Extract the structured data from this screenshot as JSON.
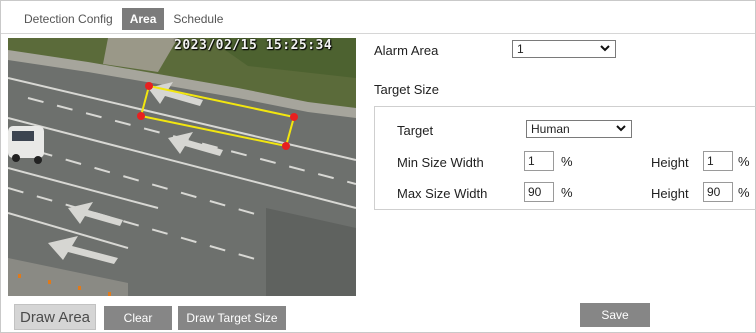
{
  "tabs": [
    {
      "label": "Detection Config",
      "active": false
    },
    {
      "label": "Area",
      "active": true
    },
    {
      "label": "Schedule",
      "active": false
    }
  ],
  "video": {
    "timestamp": "2023/02/15 15:25:34"
  },
  "form": {
    "alarm_area_label": "Alarm Area",
    "alarm_area_value": "1",
    "target_size_label": "Target Size",
    "target_label": "Target",
    "target_value": "Human",
    "min_width_label": "Min Size Width",
    "min_width_value": "1",
    "min_height_label": "Height",
    "min_height_value": "1",
    "max_width_label": "Max Size Width",
    "max_width_value": "90",
    "max_height_label": "Height",
    "max_height_value": "90",
    "unit": "%"
  },
  "buttons": {
    "draw_area": "Draw Area",
    "clear": "Clear",
    "draw_target_size": "Draw Target Size",
    "save": "Save"
  },
  "colors": {
    "active_tab": "#7b7b7b",
    "button": "#868686",
    "area_line": "#f2e60f",
    "area_corner": "#e82020"
  }
}
